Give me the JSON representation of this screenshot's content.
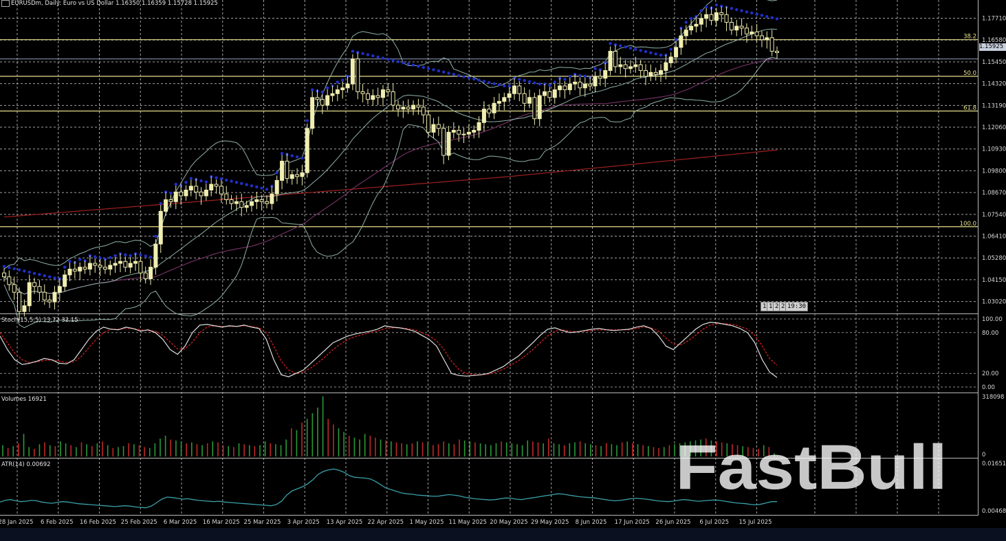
{
  "window": {
    "symbol_title": "EURUSDm, Daily: Euro vs US Dollar  1.16350 1.16359 1.15728 1.15925",
    "current_price": "1.15925"
  },
  "fibonacci": {
    "levels": [
      {
        "label": "38.2",
        "price": 1.166
      },
      {
        "label": "50.0",
        "price": 1.147
      },
      {
        "label": "61.8",
        "price": 1.129
      },
      {
        "label": "100.0",
        "price": 1.069
      }
    ],
    "extra_line_price": 1.156,
    "color": "#e8e08c"
  },
  "price_axis": {
    "labels": [
      "1.17710",
      "1.16580",
      "1.15450",
      "1.14320",
      "1.13190",
      "1.12060",
      "1.10930",
      "1.09800",
      "1.08670",
      "1.07540",
      "1.06410",
      "1.05280",
      "1.04150",
      "1.03020"
    ]
  },
  "date_axis": {
    "labels": [
      "28 Jan 2025",
      "6 Feb 2025",
      "16 Feb 2025",
      "25 Feb 2025",
      "6 Mar 2025",
      "16 Mar 2025",
      "25 Mar 2025",
      "3 Apr 2025",
      "13 Apr 2025",
      "22 Apr 2025",
      "1 May 2025",
      "11 May 2025",
      "20 May 2025",
      "29 May 2025",
      "8 Jun 2025",
      "17 Jun 2025",
      "26 Jun 2025",
      "6 Jul 2025",
      "15 Jul 2025"
    ]
  },
  "badges": [
    "1",
    "1",
    "2",
    "2",
    "19:30"
  ],
  "stochastic": {
    "title": "Stoch(15,5,5) 13.72 32.15",
    "axis_labels": [
      "100.00",
      "80.00",
      "20.00",
      "0.00"
    ]
  },
  "volumes": {
    "title": "Volumes 16921",
    "axis_labels": [
      "318098",
      "0"
    ]
  },
  "atr": {
    "title": "ATR(14) 0.00692",
    "axis_labels": [
      "0.01651",
      "0.00468"
    ]
  },
  "watermark": "FastBull",
  "colors": {
    "background": "#000000",
    "candle": "#f0eeb0",
    "sar": "#2030c8",
    "bollinger": "#90b0a8",
    "ma_long": "#a02020",
    "ma_mid": "#703060",
    "stoch_main": "#e0e0e0",
    "stoch_signal": "#d02020",
    "vol_up": "#2a9a3a",
    "vol_down": "#c02828",
    "atr": "#3aa0a8",
    "grid": "#cfcfcf"
  },
  "chart_data": [
    {
      "type": "candlestick",
      "title": "EURUSDm, Daily",
      "x_labels": [
        "28 Jan 2025",
        "6 Feb 2025",
        "16 Feb 2025",
        "25 Feb 2025",
        "6 Mar 2025",
        "16 Mar 2025",
        "25 Mar 2025",
        "3 Apr 2025",
        "13 Apr 2025",
        "22 Apr 2025",
        "1 May 2025",
        "11 May 2025",
        "20 May 2025",
        "29 May 2025",
        "8 Jun 2025",
        "17 Jun 2025",
        "26 Jun 2025",
        "6 Jul 2025",
        "15 Jul 2025"
      ],
      "close": [
        1.043,
        1.039,
        1.035,
        1.025,
        1.028,
        1.04,
        1.038,
        1.035,
        1.031,
        1.03,
        1.035,
        1.038,
        1.044,
        1.047,
        1.046,
        1.048,
        1.047,
        1.05,
        1.049,
        1.048,
        1.047,
        1.049,
        1.05,
        1.051,
        1.048,
        1.05,
        1.051,
        1.045,
        1.042,
        1.048,
        1.06,
        1.077,
        1.083,
        1.082,
        1.087,
        1.085,
        1.088,
        1.09,
        1.087,
        1.085,
        1.088,
        1.091,
        1.09,
        1.086,
        1.083,
        1.081,
        1.082,
        1.079,
        1.08,
        1.082,
        1.083,
        1.082,
        1.081,
        1.086,
        1.093,
        1.103,
        1.094,
        1.096,
        1.095,
        1.097,
        1.12,
        1.136,
        1.135,
        1.132,
        1.137,
        1.138,
        1.14,
        1.141,
        1.143,
        1.156,
        1.139,
        1.138,
        1.135,
        1.137,
        1.136,
        1.14,
        1.139,
        1.132,
        1.13,
        1.131,
        1.13,
        1.132,
        1.131,
        1.127,
        1.118,
        1.122,
        1.12,
        1.106,
        1.118,
        1.119,
        1.117,
        1.117,
        1.118,
        1.119,
        1.123,
        1.13,
        1.128,
        1.133,
        1.134,
        1.136,
        1.138,
        1.142,
        1.138,
        1.133,
        1.136,
        1.125,
        1.137,
        1.139,
        1.136,
        1.14,
        1.142,
        1.14,
        1.143,
        1.144,
        1.141,
        1.143,
        1.142,
        1.147,
        1.146,
        1.15,
        1.16,
        1.152,
        1.153,
        1.151,
        1.152,
        1.153,
        1.15,
        1.147,
        1.149,
        1.148,
        1.15,
        1.154,
        1.157,
        1.162,
        1.168,
        1.171,
        1.173,
        1.174,
        1.177,
        1.179,
        1.176,
        1.18,
        1.179,
        1.175,
        1.171,
        1.173,
        1.172,
        1.169,
        1.17,
        1.168,
        1.166,
        1.167,
        1.16,
        1.1593
      ],
      "open_offsets_note": "",
      "ylim": [
        1.024,
        1.183
      ],
      "price_axis_ticks": [
        1.1771,
        1.1658,
        1.1545,
        1.1432,
        1.1319,
        1.1206,
        1.1093,
        1.098,
        1.0867,
        1.0754,
        1.0641,
        1.0528,
        1.0415,
        1.0302
      ]
    },
    {
      "type": "line",
      "title": "Stoch(15,5,5) 13.72 32.15",
      "series": [
        {
          "name": "main",
          "values": [
            75,
            55,
            40,
            33,
            35,
            38,
            42,
            40,
            35,
            34,
            40,
            55,
            70,
            82,
            88,
            85,
            84,
            88,
            86,
            82,
            84,
            80,
            70,
            55,
            48,
            60,
            80,
            91,
            92,
            90,
            88,
            90,
            89,
            91,
            88,
            86,
            70,
            40,
            18,
            15,
            20,
            25,
            35,
            45,
            55,
            65,
            70,
            75,
            78,
            80,
            82,
            85,
            90,
            88,
            87,
            85,
            82,
            76,
            70,
            60,
            40,
            20,
            17,
            16,
            17,
            18,
            20,
            25,
            30,
            38,
            45,
            55,
            65,
            76,
            85,
            87,
            83,
            80,
            81,
            83,
            85,
            86,
            84,
            83,
            84,
            85,
            88,
            90,
            86,
            75,
            60,
            55,
            65,
            75,
            85,
            92,
            95,
            94,
            92,
            90,
            86,
            80,
            65,
            40,
            22,
            14
          ]
        },
        {
          "name": "signal",
          "values": [
            80,
            65,
            50,
            40,
            36,
            37,
            39,
            40,
            38,
            36,
            37,
            45,
            58,
            70,
            80,
            85,
            85,
            86,
            86,
            84,
            83,
            82,
            76,
            66,
            56,
            56,
            66,
            80,
            88,
            90,
            89,
            89,
            89,
            90,
            89,
            87,
            80,
            60,
            38,
            25,
            20,
            22,
            28,
            36,
            45,
            55,
            63,
            70,
            74,
            77,
            80,
            82,
            86,
            87,
            87,
            86,
            84,
            80,
            75,
            68,
            55,
            38,
            26,
            20,
            18,
            18,
            19,
            22,
            26,
            32,
            38,
            46,
            55,
            65,
            75,
            82,
            84,
            82,
            81,
            82,
            83,
            84,
            84,
            84,
            84,
            84,
            86,
            88,
            87,
            82,
            72,
            63,
            62,
            68,
            76,
            85,
            91,
            93,
            93,
            92,
            89,
            85,
            76,
            60,
            42,
            32
          ]
        }
      ],
      "ylim": [
        0,
        100
      ],
      "axis_ticks": [
        100,
        80,
        20,
        0
      ]
    },
    {
      "type": "bar",
      "title": "Volumes 16921",
      "ylim": [
        0,
        318098
      ],
      "values": [
        60000,
        45000,
        55000,
        70000,
        120000,
        50000,
        40000,
        65000,
        75000,
        60000,
        55000,
        80000,
        70000,
        60000,
        50000,
        75000,
        65000,
        55000,
        70000,
        80000,
        60000,
        45000,
        50000,
        55000,
        70000,
        65000,
        60000,
        50000,
        45000,
        70000,
        95000,
        110000,
        90000,
        85000,
        80000,
        70000,
        75000,
        65000,
        60000,
        70000,
        80000,
        75000,
        60000,
        55000,
        50000,
        70000,
        65000,
        60000,
        55000,
        60000,
        80000,
        70000,
        65000,
        60000,
        90000,
        150000,
        140000,
        180000,
        200000,
        230000,
        260000,
        320000,
        200000,
        170000,
        150000,
        130000,
        110000,
        100000,
        90000,
        120000,
        110000,
        100000,
        90000,
        85000,
        80000,
        75000,
        70000,
        65000,
        70000,
        80000,
        75000,
        70000,
        60000,
        65000,
        80000,
        70000,
        65000,
        90000,
        85000,
        80000,
        75000,
        70000,
        65000,
        60000,
        70000,
        80000,
        75000,
        70000,
        65000,
        60000,
        85000,
        80000,
        75000,
        70000,
        95000,
        70000,
        65000,
        60000,
        70000,
        75000,
        80000,
        70000,
        65000,
        60000,
        55000,
        70000,
        65000,
        60000,
        75000,
        80000,
        70000,
        65000,
        60000,
        55000,
        50000,
        45000,
        50000,
        60000,
        65000,
        70000,
        75000,
        80000,
        85000,
        90000,
        95000,
        85000,
        80000,
        75000,
        70000,
        65000,
        60000,
        55000,
        50000,
        45000,
        40000,
        60000,
        50000,
        16921
      ],
      "up": [
        true,
        false,
        true,
        false,
        true,
        true,
        false,
        true,
        false,
        true,
        false,
        true,
        true,
        false,
        true,
        false,
        true,
        false,
        true,
        false,
        true,
        false,
        true,
        true,
        false,
        true,
        false,
        false,
        true,
        true,
        true,
        true,
        false,
        true,
        true,
        false,
        true,
        false,
        true,
        false,
        true,
        false,
        false,
        true,
        false,
        true,
        false,
        true,
        false,
        true,
        true,
        false,
        true,
        true,
        true,
        false,
        true,
        false,
        true,
        true,
        true,
        true,
        false,
        false,
        true,
        true,
        false,
        true,
        true,
        true,
        false,
        false,
        true,
        false,
        true,
        false,
        false,
        true,
        false,
        true,
        false,
        true,
        false,
        false,
        false,
        true,
        false,
        false,
        true,
        true,
        false,
        true,
        true,
        true,
        true,
        false,
        true,
        true,
        true,
        true,
        true,
        false,
        false,
        true,
        false,
        true,
        true,
        false,
        true,
        true,
        false,
        true,
        true,
        false,
        true,
        false,
        true,
        true,
        false,
        true,
        false,
        true,
        false,
        true,
        false,
        false,
        true,
        false,
        true,
        true,
        true,
        true,
        true,
        true,
        false,
        true,
        false,
        false,
        true,
        false,
        false,
        true,
        false,
        false,
        false,
        true,
        false,
        true
      ]
    },
    {
      "type": "line",
      "title": "ATR(14) 0.00692",
      "ylim": [
        0.00468,
        0.01651
      ],
      "axis_ticks": [
        0.01651,
        0.00468
      ],
      "series": [
        {
          "name": "ATR",
          "values": [
            0.0068,
            0.0072,
            0.0074,
            0.0071,
            0.0069,
            0.007,
            0.0072,
            0.0071,
            0.0068,
            0.0066,
            0.0065,
            0.0067,
            0.0069,
            0.0068,
            0.0066,
            0.0064,
            0.0063,
            0.0062,
            0.0061,
            0.006,
            0.0059,
            0.0058,
            0.0057,
            0.0058,
            0.0059,
            0.0058,
            0.0056,
            0.0055,
            0.0054,
            0.0058,
            0.0066,
            0.0075,
            0.008,
            0.0079,
            0.0077,
            0.0075,
            0.0076,
            0.0074,
            0.0072,
            0.0071,
            0.007,
            0.0069,
            0.007,
            0.0068,
            0.0067,
            0.0066,
            0.0065,
            0.0064,
            0.0063,
            0.0062,
            0.0061,
            0.006,
            0.0059,
            0.0062,
            0.007,
            0.0085,
            0.0095,
            0.01,
            0.0105,
            0.0112,
            0.0122,
            0.0135,
            0.0142,
            0.0146,
            0.0148,
            0.0145,
            0.014,
            0.0132,
            0.0128,
            0.0127,
            0.0126,
            0.0124,
            0.0118,
            0.011,
            0.0102,
            0.0098,
            0.0094,
            0.009,
            0.0088,
            0.0087,
            0.0085,
            0.0084,
            0.0083,
            0.0082,
            0.0082,
            0.0084,
            0.0086,
            0.0085,
            0.0083,
            0.008,
            0.0078,
            0.0076,
            0.0075,
            0.0074,
            0.0073,
            0.0074,
            0.0076,
            0.0078,
            0.0077,
            0.0075,
            0.0074,
            0.0076,
            0.0078,
            0.008,
            0.0082,
            0.0084,
            0.0086,
            0.0088,
            0.0087,
            0.0085,
            0.0083,
            0.0081,
            0.008,
            0.0079,
            0.0078,
            0.0076,
            0.0074,
            0.0072,
            0.0071,
            0.0072,
            0.0074,
            0.0076,
            0.0077,
            0.0076,
            0.0075,
            0.0073,
            0.0071,
            0.007,
            0.0069,
            0.007,
            0.0072,
            0.0074,
            0.0073,
            0.0071,
            0.007,
            0.0071,
            0.0072,
            0.0073,
            0.0072,
            0.007,
            0.0068,
            0.0066,
            0.0065,
            0.0064,
            0.0062,
            0.0061,
            0.0063,
            0.0066,
            0.0069,
            0.0069
          ]
        }
      ]
    }
  ]
}
